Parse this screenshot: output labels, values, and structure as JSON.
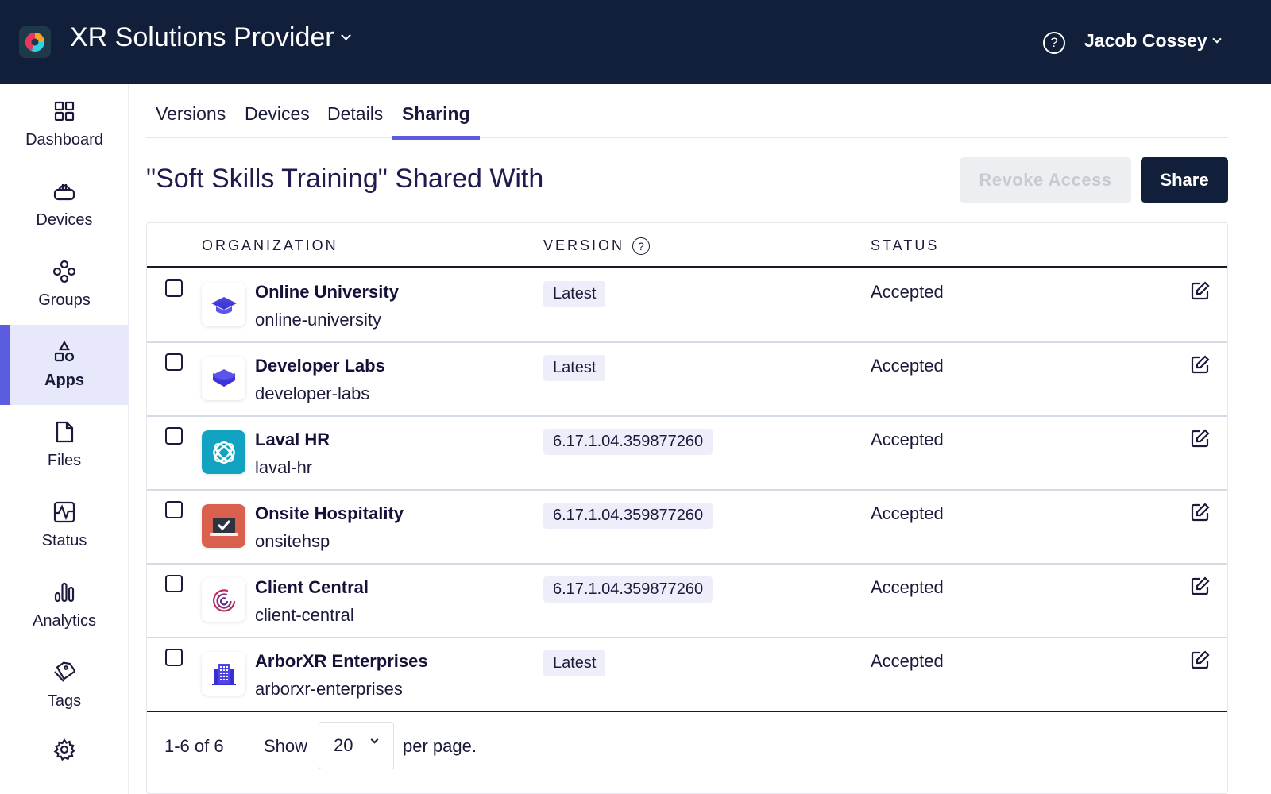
{
  "header": {
    "org_name": "XR Solutions Provider",
    "user_name": "Jacob Cossey",
    "help_icon": "question-circle-icon"
  },
  "sidebar": {
    "items": [
      {
        "label": "Dashboard",
        "icon": "grid-icon",
        "active": false
      },
      {
        "label": "Devices",
        "icon": "vr-headset-icon",
        "active": false
      },
      {
        "label": "Groups",
        "icon": "groups-icon",
        "active": false
      },
      {
        "label": "Apps",
        "icon": "apps-shapes-icon",
        "active": true
      },
      {
        "label": "Files",
        "icon": "file-icon",
        "active": false
      },
      {
        "label": "Status",
        "icon": "pulse-icon",
        "active": false
      },
      {
        "label": "Analytics",
        "icon": "bar-chart-icon",
        "active": false
      },
      {
        "label": "Tags",
        "icon": "tag-icon",
        "active": false
      },
      {
        "label": "",
        "icon": "gear-icon",
        "active": false
      }
    ]
  },
  "tabs": [
    {
      "label": "Versions",
      "active": false
    },
    {
      "label": "Devices",
      "active": false
    },
    {
      "label": "Details",
      "active": false
    },
    {
      "label": "Sharing",
      "active": true
    }
  ],
  "page": {
    "title": "\"Soft Skills Training\" Shared With",
    "revoke_label": "Revoke Access",
    "share_label": "Share"
  },
  "table": {
    "columns": [
      "ORGANIZATION",
      "VERSION",
      "STATUS"
    ],
    "rows": [
      {
        "name": "Online University",
        "slug": "online-university",
        "version": "Latest",
        "status": "Accepted",
        "logo": "graduation-cap-icon"
      },
      {
        "name": "Developer Labs",
        "slug": "developer-labs",
        "version": "Latest",
        "status": "Accepted",
        "logo": "layers-icon"
      },
      {
        "name": "Laval HR",
        "slug": "laval-hr",
        "version": "6.17.1.04.359877260",
        "status": "Accepted",
        "logo": "knot-icon"
      },
      {
        "name": "Onsite Hospitality",
        "slug": "onsitehsp",
        "version": "6.17.1.04.359877260",
        "status": "Accepted",
        "logo": "laptop-check-icon"
      },
      {
        "name": "Client Central",
        "slug": "client-central",
        "version": "6.17.1.04.359877260",
        "status": "Accepted",
        "logo": "spiral-icon"
      },
      {
        "name": "ArborXR Enterprises",
        "slug": "arborxr-enterprises",
        "version": "Latest",
        "status": "Accepted",
        "logo": "building-icon"
      }
    ]
  },
  "pagination": {
    "count": "1-6 of 6",
    "show_label": "Show",
    "per_page_value": "20",
    "per_page_suffix": "per page."
  },
  "colors": {
    "topbar": "#111f3a",
    "accent": "#5b5ce0",
    "active_nav_bg": "#e8e8fb",
    "badge_bg": "#eeeefb"
  }
}
